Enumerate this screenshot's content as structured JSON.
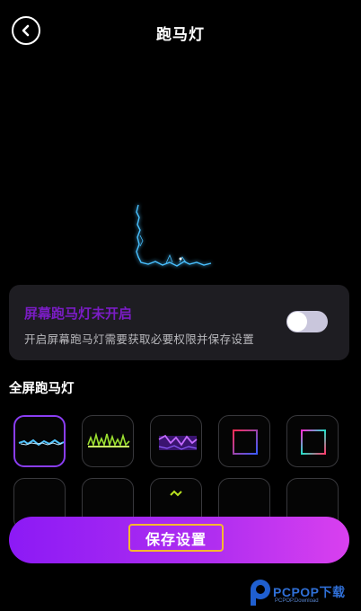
{
  "header": {
    "title": "跑马灯",
    "back_icon": "chevron-left-icon"
  },
  "preview": {
    "description": "lightning-border-preview",
    "color": "#3fb6ff"
  },
  "status_card": {
    "title": "屏幕跑马灯未开启",
    "description": "开启屏幕跑马灯需要获取必要权限并保存设置",
    "toggle_on": false,
    "title_color": "#7a1cc4"
  },
  "section": {
    "title": "全屏跑马灯"
  },
  "styles": [
    {
      "name": "blue-lightning",
      "selected": true
    },
    {
      "name": "green-lightning",
      "selected": false
    },
    {
      "name": "purple-lightning",
      "selected": false
    },
    {
      "name": "red-blue-frame",
      "selected": false
    },
    {
      "name": "rainbow-frame",
      "selected": false
    },
    {
      "name": "style-6",
      "selected": false
    },
    {
      "name": "style-7",
      "selected": false
    },
    {
      "name": "style-8",
      "selected": false
    },
    {
      "name": "style-9",
      "selected": false
    },
    {
      "name": "style-10",
      "selected": false
    }
  ],
  "save_button": {
    "label": "保存设置"
  },
  "watermark": {
    "text": "PCPOP下载",
    "sub": "PCPOP.Download"
  },
  "colors": {
    "accent": "#8c1af5",
    "selected_border": "#8a3df2",
    "highlight_box": "#f5b92e"
  }
}
